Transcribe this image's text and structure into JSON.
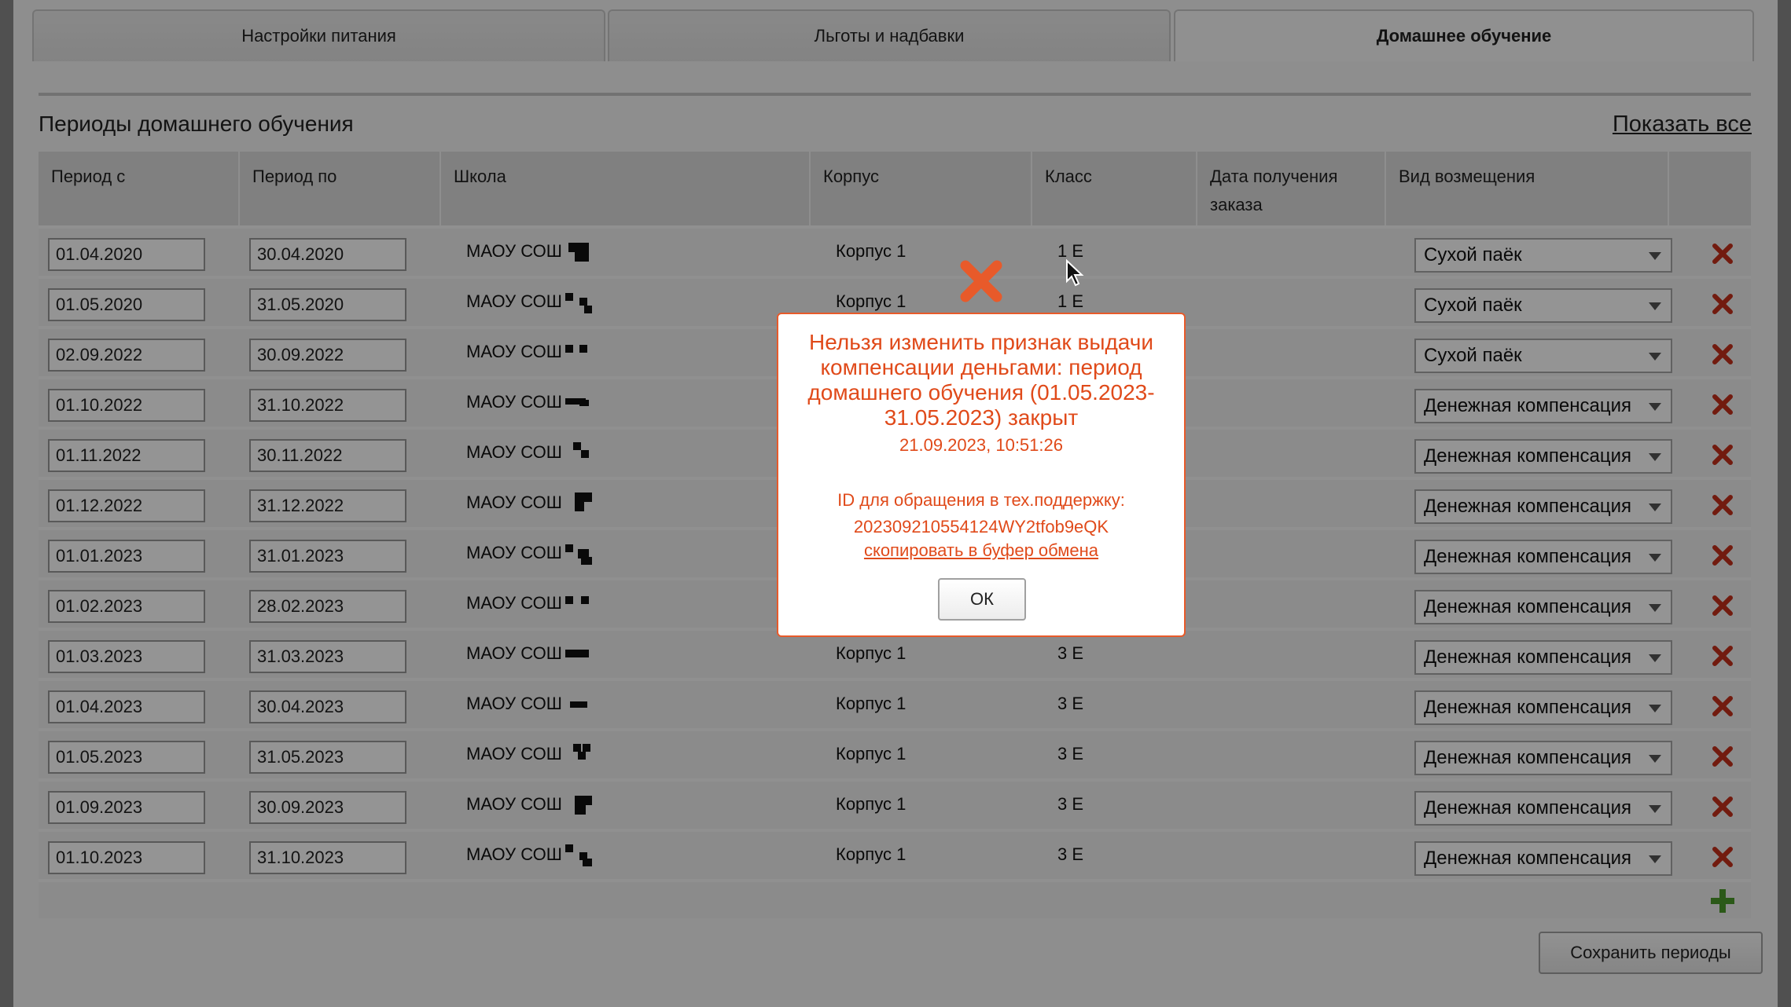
{
  "tabs": [
    {
      "label": "Настройки питания",
      "active": false
    },
    {
      "label": "Льготы и надбавки",
      "active": false
    },
    {
      "label": "Домашнее обучение",
      "active": true
    }
  ],
  "section": {
    "title": "Периоды домашнего обучения",
    "show_all": "Показать все"
  },
  "columns": [
    "Период с",
    "Период по",
    "Школа",
    "Корпус",
    "Класс",
    "Дата получения заказа",
    "Вид возмещения"
  ],
  "rows": [
    {
      "from": "01.04.2020",
      "to": "30.04.2020",
      "school": "МАОУ СОШ",
      "building": "Корпус 1",
      "class": "1 Е",
      "order_date": "",
      "type": "Сухой паёк"
    },
    {
      "from": "01.05.2020",
      "to": "31.05.2020",
      "school": "МАОУ СОШ",
      "building": "Корпус 1",
      "class": "1 Е",
      "order_date": "",
      "type": "Сухой паёк"
    },
    {
      "from": "02.09.2022",
      "to": "30.09.2022",
      "school": "МАОУ СОШ",
      "building": "",
      "class": "",
      "order_date": "",
      "type": "Сухой паёк"
    },
    {
      "from": "01.10.2022",
      "to": "31.10.2022",
      "school": "МАОУ СОШ",
      "building": "",
      "class": "",
      "order_date": "",
      "type": "Денежная компенсация"
    },
    {
      "from": "01.11.2022",
      "to": "30.11.2022",
      "school": "МАОУ СОШ",
      "building": "",
      "class": "",
      "order_date": "",
      "type": "Денежная компенсация"
    },
    {
      "from": "01.12.2022",
      "to": "31.12.2022",
      "school": "МАОУ СОШ",
      "building": "",
      "class": "",
      "order_date": "",
      "type": "Денежная компенсация"
    },
    {
      "from": "01.01.2023",
      "to": "31.01.2023",
      "school": "МАОУ СОШ",
      "building": "",
      "class": "",
      "order_date": "",
      "type": "Денежная компенсация"
    },
    {
      "from": "01.02.2023",
      "to": "28.02.2023",
      "school": "МАОУ СОШ",
      "building": "",
      "class": "",
      "order_date": "",
      "type": "Денежная компенсация"
    },
    {
      "from": "01.03.2023",
      "to": "31.03.2023",
      "school": "МАОУ СОШ",
      "building": "Корпус 1",
      "class": "3 Е",
      "order_date": "",
      "type": "Денежная компенсация"
    },
    {
      "from": "01.04.2023",
      "to": "30.04.2023",
      "school": "МАОУ СОШ",
      "building": "Корпус 1",
      "class": "3 Е",
      "order_date": "",
      "type": "Денежная компенсация"
    },
    {
      "from": "01.05.2023",
      "to": "31.05.2023",
      "school": "МАОУ СОШ",
      "building": "Корпус 1",
      "class": "3 Е",
      "order_date": "",
      "type": "Денежная компенсация"
    },
    {
      "from": "01.09.2023",
      "to": "30.09.2023",
      "school": "МАОУ СОШ",
      "building": "Корпус 1",
      "class": "3 Е",
      "order_date": "",
      "type": "Денежная компенсация"
    },
    {
      "from": "01.10.2023",
      "to": "31.10.2023",
      "school": "МАОУ СОШ",
      "building": "Корпус 1",
      "class": "3 Е",
      "order_date": "",
      "type": "Денежная компенсация"
    }
  ],
  "save_label": "Сохранить периоды",
  "dialog": {
    "message": "Нельзя изменить признак выдачи компенсации деньгами: период домашнего обучения (01.05.2023-31.05.2023) закрыт",
    "timestamp": "21.09.2023, 10:51:26",
    "support_label": "ID для обращения в тех.поддержку:",
    "support_id": "202309210554124WY2tfob9eQK",
    "copy_label": "скопировать в буфер обмена",
    "ok_label": "ОК"
  },
  "colors": {
    "error": "#e04a1a",
    "delete": "#c4301a",
    "add": "#4a9a2a",
    "overlay": "rgba(0,0,0,0.42)"
  },
  "icons": [
    "delete-icon",
    "add-icon",
    "error-icon",
    "dropdown-arrow-icon",
    "mouse-cursor-icon"
  ]
}
